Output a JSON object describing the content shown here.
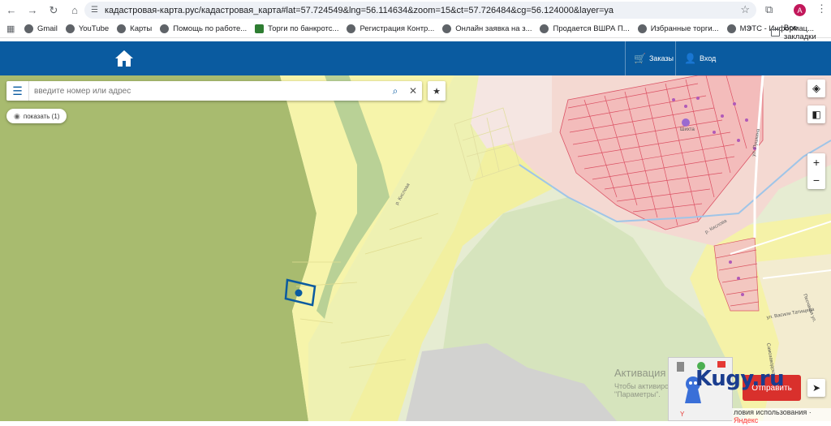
{
  "browser": {
    "url": "кадастровая-карта.рус/кадастровая_карта#lat=57.724549&lng=56.114634&zoom=15&ct=57.726484&cg=56.124000&layer=ya",
    "avatar_letter": "A"
  },
  "bookmarks": {
    "items": [
      {
        "label": "Gmail"
      },
      {
        "label": "YouTube"
      },
      {
        "label": "Карты"
      },
      {
        "label": "Помощь по работе..."
      },
      {
        "label": "Торги по банкротс..."
      },
      {
        "label": "Регистрация Контр..."
      },
      {
        "label": "Онлайн заявка на з..."
      },
      {
        "label": "Продается ВШРА П..."
      },
      {
        "label": "Избранные торги..."
      },
      {
        "label": "МЭТС - Информац..."
      }
    ],
    "more": "»",
    "all_label": "Все закладки"
  },
  "header": {
    "orders_label": "Заказы",
    "login_label": "Вход",
    "bg_color": "#0a5ba0"
  },
  "search": {
    "placeholder": "введите номер или адрес"
  },
  "show_button": {
    "label": "показать (1)"
  },
  "map": {
    "street_labels": [
      "р. Кислова",
      "ул. Пушкина",
      "ул. Васили Татищева",
      "Песчаная ул.",
      "Самозаводска ул."
    ],
    "place_label": "Шихта"
  },
  "activation": {
    "title": "Активация",
    "line1": "Чтобы активиров",
    "line2": "\"Параметры\"."
  },
  "watermark": {
    "text": "Kugy.ru"
  },
  "red_button": {
    "label": "Отправить"
  },
  "attribution": {
    "terms": "ловия использования",
    "provider": "Яндекс"
  },
  "colors": {
    "forest": "#a9bd6e",
    "field_yellow": "#f4f3a6",
    "green": "#c7d9a8",
    "parcel_red": "#d9455a",
    "accent_blue": "#0a5ba0"
  }
}
